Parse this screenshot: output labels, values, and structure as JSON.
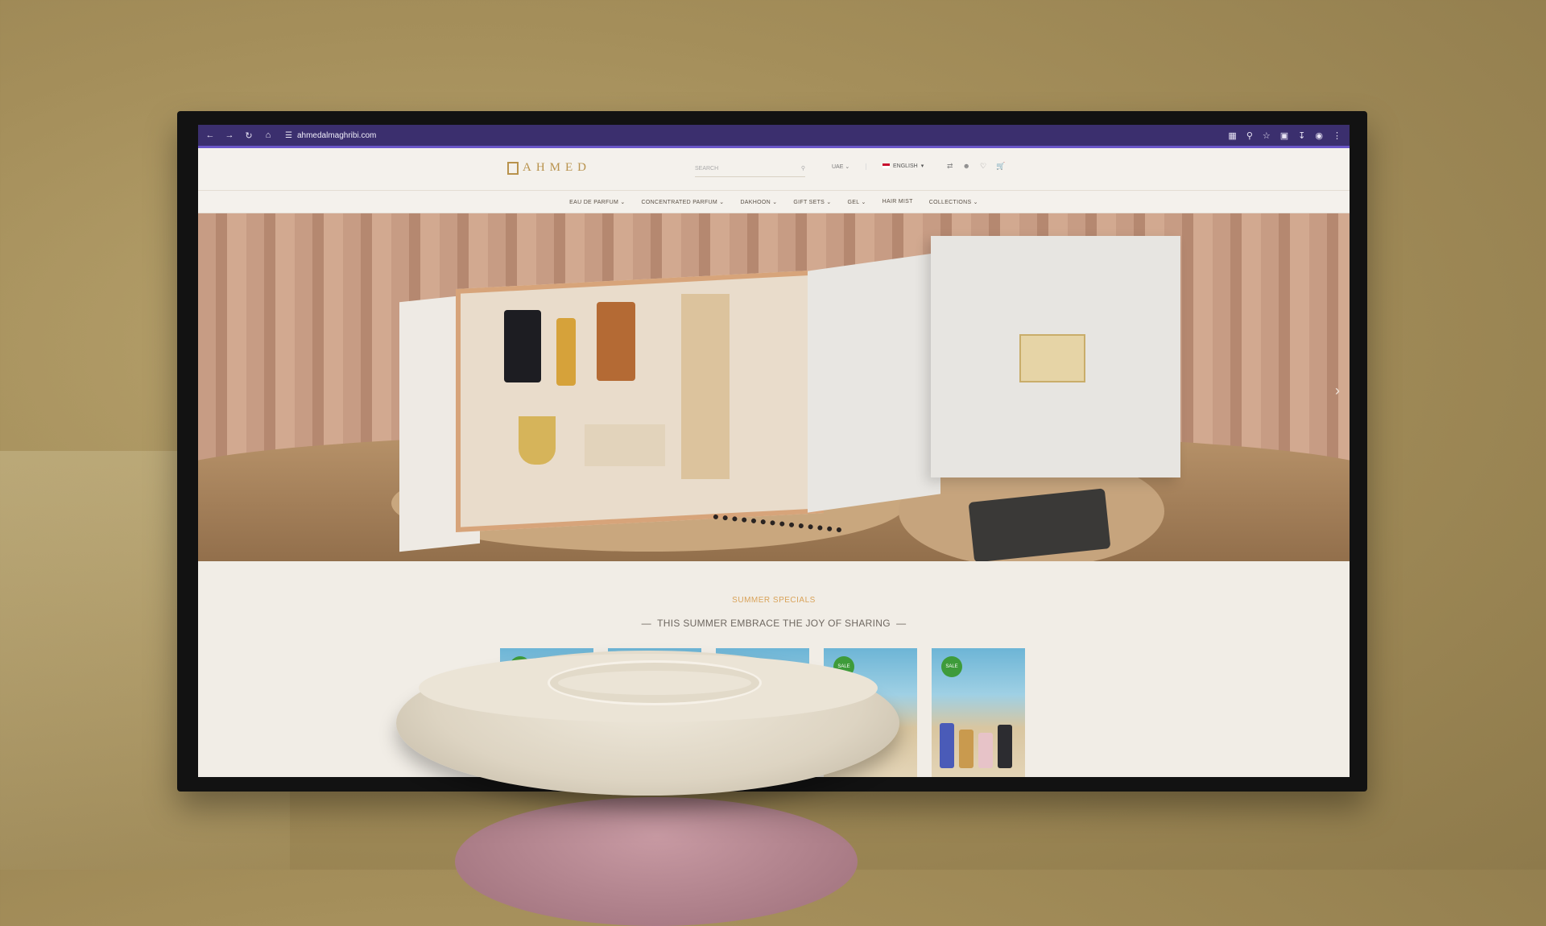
{
  "browser": {
    "url": "ahmedalmaghribi.com",
    "nav_icons": [
      "back-icon",
      "forward-icon",
      "reload-icon",
      "home-icon"
    ],
    "toolbar_icons": [
      "translate-icon",
      "zoom-icon",
      "star-icon",
      "extensions-icon",
      "download-icon",
      "profile-icon",
      "menu-icon"
    ]
  },
  "header": {
    "logo_text": "AHMED",
    "search_placeholder": "SEARCH",
    "currency": "UAE",
    "language": "ENGLISH"
  },
  "menu": {
    "items": [
      {
        "label": "EAU DE PARFUM",
        "has_dropdown": true
      },
      {
        "label": "CONCENTRATED PARFUM",
        "has_dropdown": true
      },
      {
        "label": "DAKHOON",
        "has_dropdown": true
      },
      {
        "label": "GIFT SETS",
        "has_dropdown": true
      },
      {
        "label": "GEL",
        "has_dropdown": true
      },
      {
        "label": "HAIR MIST",
        "has_dropdown": false
      },
      {
        "label": "COLLECTIONS",
        "has_dropdown": true
      }
    ]
  },
  "summer": {
    "kicker": "SUMMER SPECIALS",
    "title": "THIS SUMMER EMBRACE THE JOY OF SHARING",
    "badge_label": "SALE"
  },
  "colors": {
    "accent_gold": "#b8924c",
    "browser_bar": "#3b2f6e",
    "sale_badge": "#3e9b3a",
    "kicker": "#d9a35a"
  }
}
